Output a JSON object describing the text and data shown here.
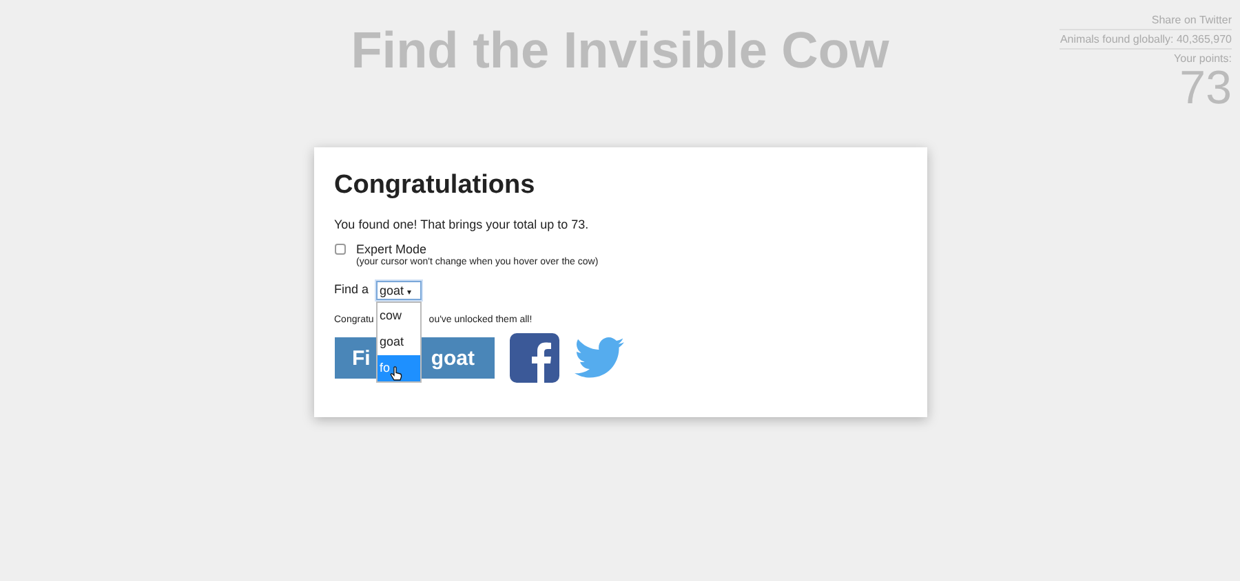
{
  "title": "Find the Invisible Cow",
  "stats": {
    "share_link": "Share on Twitter",
    "animals_found": "Animals found globally: 40,365,970",
    "points_label": "Your points:",
    "points": "73"
  },
  "card": {
    "heading": "Congratulations",
    "message": "You found one! That brings your total up to 73.",
    "expert_mode": {
      "label": "Expert Mode",
      "hint": "(your cursor won't change when you hover over the cow)",
      "checked": false
    },
    "find_label": "Find a",
    "select": {
      "value": "goat",
      "caret": "▾",
      "expanded": true,
      "options": [
        {
          "label": "cow",
          "highlighted": false
        },
        {
          "label": "goat",
          "highlighted": false
        },
        {
          "label": "fo",
          "highlighted": true
        }
      ]
    },
    "unlock_text_parts": [
      "Congratu",
      "ou've unlocked them all!"
    ],
    "find_button_parts": [
      "Fi",
      "goat"
    ]
  }
}
